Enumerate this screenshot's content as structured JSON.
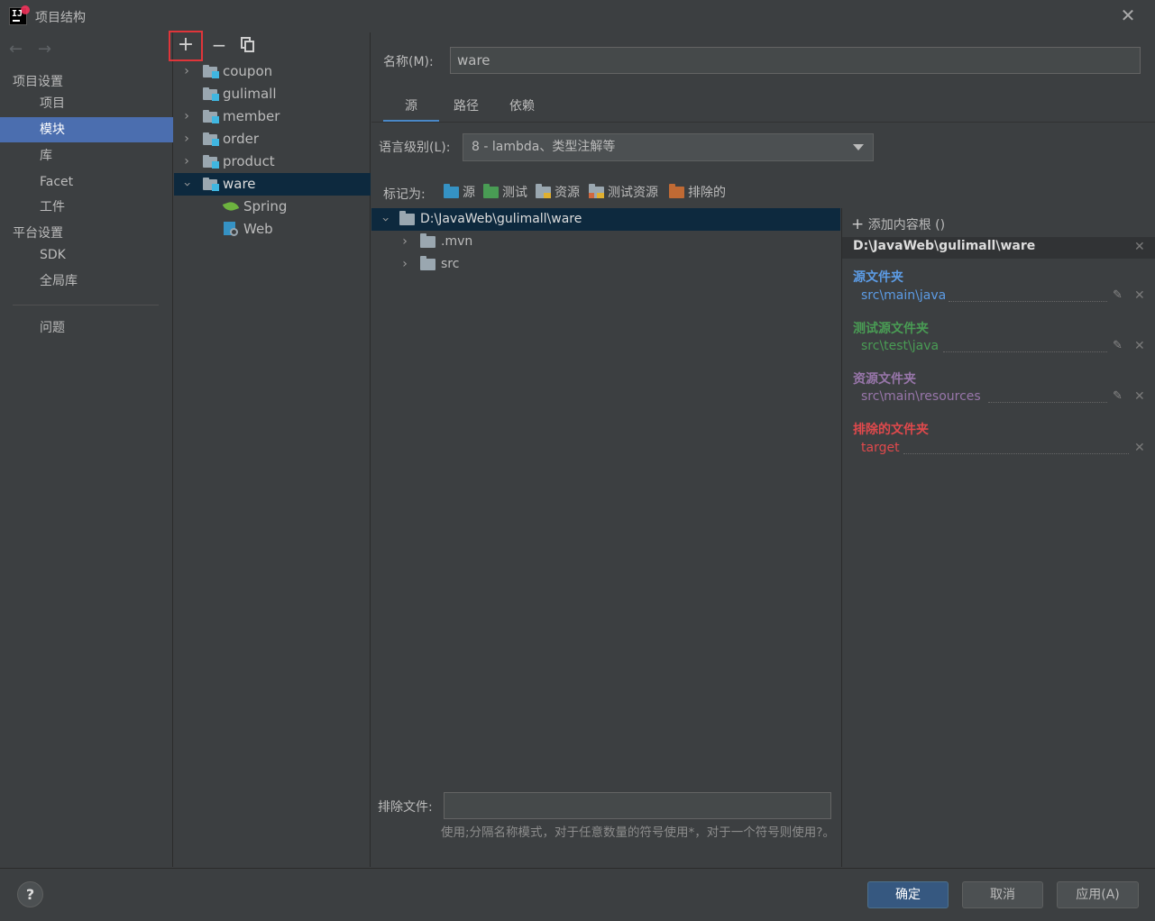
{
  "window": {
    "title": "项目结构",
    "close_glyph": "✕",
    "app_icon_text": "IJ"
  },
  "nav": {
    "back_glyph": "←",
    "forward_glyph": "→"
  },
  "sidebar": {
    "project_settings_header": "项目设置",
    "project_settings_items": [
      {
        "label": "项目",
        "selected": false
      },
      {
        "label": "模块",
        "selected": true
      },
      {
        "label": "库",
        "selected": false
      },
      {
        "label": "Facet",
        "selected": false
      },
      {
        "label": "工件",
        "selected": false
      }
    ],
    "platform_settings_header": "平台设置",
    "platform_settings_items": [
      {
        "label": "SDK"
      },
      {
        "label": "全局库"
      }
    ],
    "problems_label": "问题"
  },
  "module_toolbar": {
    "add_glyph": "+",
    "remove_glyph": "−"
  },
  "modules": [
    {
      "label": "coupon",
      "expandable": true,
      "expanded": false
    },
    {
      "label": "gulimall",
      "expandable": false
    },
    {
      "label": "member",
      "expandable": true,
      "expanded": false
    },
    {
      "label": "order",
      "expandable": true,
      "expanded": false
    },
    {
      "label": "product",
      "expandable": true,
      "expanded": false
    },
    {
      "label": "ware",
      "expandable": true,
      "expanded": true,
      "selected": true,
      "children": [
        {
          "label": "Spring",
          "icon": "spring-leaf-icon"
        },
        {
          "label": "Web",
          "icon": "web-icon"
        }
      ]
    }
  ],
  "detail": {
    "name_label": "名称(M):",
    "name_value": "ware",
    "tabs": [
      {
        "label": "源",
        "active": true
      },
      {
        "label": "路径",
        "active": false
      },
      {
        "label": "依赖",
        "active": false
      }
    ],
    "language_level_label": "语言级别(L):",
    "language_level_value": "8 - lambda、类型注解等",
    "mark_as_label": "标记为:",
    "mark_options": [
      {
        "label": "源",
        "color": "#3592c4"
      },
      {
        "label": "测试",
        "color": "#499c54"
      },
      {
        "label": "资源",
        "color": "#9aa7b0"
      },
      {
        "label": "测试资源",
        "color": "#9aa7b0"
      },
      {
        "label": "排除的",
        "color": "#c06a34"
      }
    ],
    "content_tree": [
      {
        "label": "D:\\JavaWeb\\gulimall\\ware",
        "level": 0,
        "expanded": true,
        "selected": true
      },
      {
        "label": ".mvn",
        "level": 1,
        "expanded": false
      },
      {
        "label": "src",
        "level": 1,
        "expanded": false
      }
    ],
    "exclude_files_label": "排除文件:",
    "exclude_files_value": "",
    "exclude_hint": "使用;分隔名称模式，对于任意数量的符号使用*，对于一个符号则使用?。"
  },
  "content_roots": {
    "add_root_label": "添加内容根 ()",
    "root_path": "D:\\JavaWeb\\gulimall\\ware",
    "groups": [
      {
        "header": "源文件夹",
        "path": "src\\main\\java",
        "color": "#5c9ce6",
        "editable": true
      },
      {
        "header": "测试源文件夹",
        "path": "src\\test\\java",
        "color": "#499c54",
        "editable": true
      },
      {
        "header": "资源文件夹",
        "path": "src\\main\\resources",
        "color": "#9876aa",
        "editable": true
      },
      {
        "header": "排除的文件夹",
        "path": "target",
        "color": "#e0494c",
        "editable": false
      }
    ]
  },
  "footer": {
    "help_glyph": "?",
    "ok_label": "确定",
    "cancel_label": "取消",
    "apply_label": "应用(A)"
  }
}
